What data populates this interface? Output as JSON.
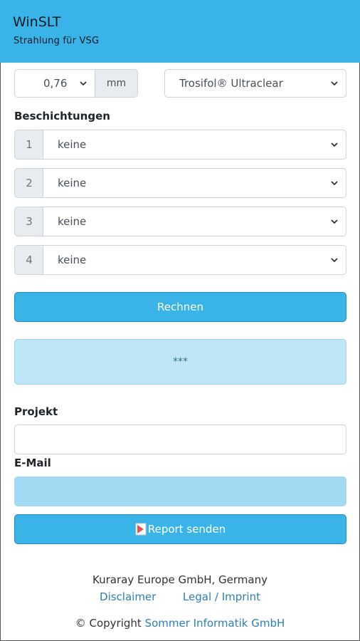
{
  "header": {
    "title": "WinSLT",
    "subtitle": "Strahlung für VSG"
  },
  "thickness": {
    "value": "0,76",
    "unit": "mm"
  },
  "interlayer": {
    "value": "Trosifol® Ultraclear"
  },
  "coatings": {
    "label": "Beschichtungen",
    "rows": [
      {
        "num": "1",
        "value": "keine"
      },
      {
        "num": "2",
        "value": "keine"
      },
      {
        "num": "3",
        "value": "keine"
      },
      {
        "num": "4",
        "value": "keine"
      }
    ]
  },
  "calc_button": "Rechnen",
  "result": "***",
  "project": {
    "label": "Projekt",
    "value": ""
  },
  "email": {
    "label": "E-Mail",
    "value": ""
  },
  "report_button": "Report senden",
  "footer": {
    "company": "Kuraray Europe GmbH, Germany",
    "disclaimer": "Disclaimer",
    "legal": "Legal / Imprint",
    "copyright_prefix": "© Copyright",
    "copyright_link": "Sommer Informatik GmbH"
  },
  "colors": {
    "accent": "#3ab4e8",
    "email_field": "#a4d9f3",
    "result_box": "#bfe6f7",
    "link": "#2f7fb6"
  },
  "icons": {
    "select": "chevron-down-icon",
    "report": "pdf-icon"
  }
}
